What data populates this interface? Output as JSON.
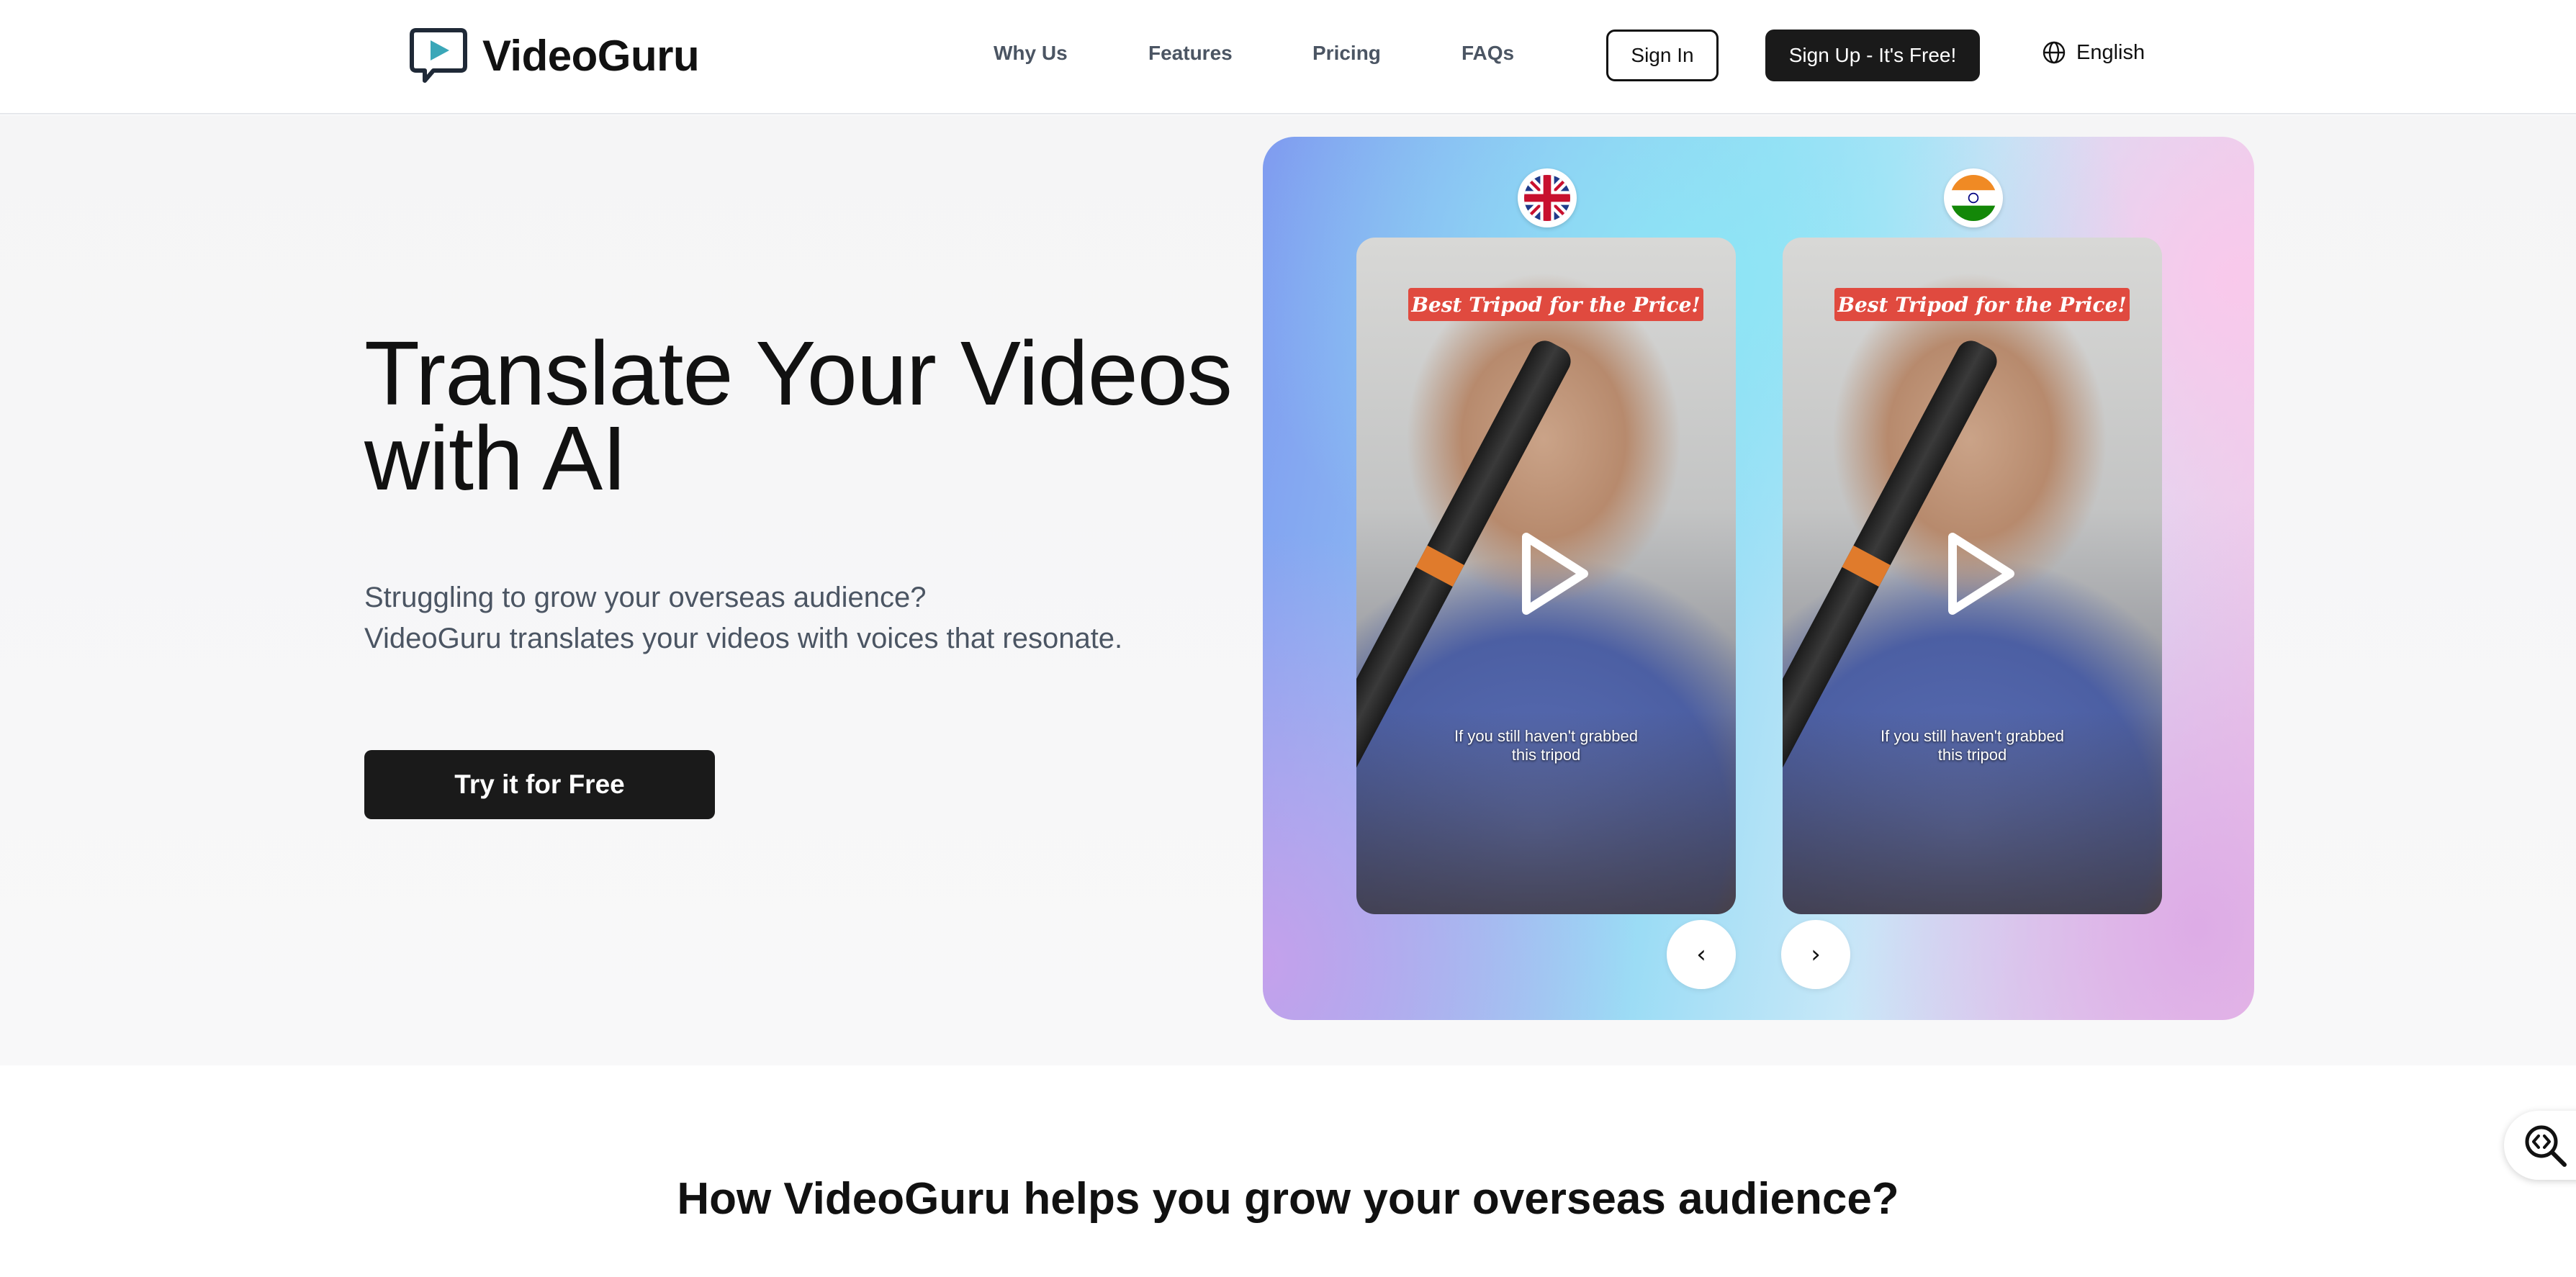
{
  "brand": {
    "name": "VideoGuru",
    "accent": "#3aa7b8"
  },
  "nav": {
    "links": [
      "Why Us",
      "Features",
      "Pricing",
      "FAQs"
    ],
    "sign_in": "Sign In",
    "sign_up": "Sign Up - It's Free!",
    "language": "English"
  },
  "hero": {
    "title_line1": "Translate Your Videos",
    "title_line2": "with AI",
    "subtitle_line1": "Struggling to grow your overseas audience?",
    "subtitle_line2": "VideoGuru translates your videos with voices that resonate.",
    "cta": "Try it for Free"
  },
  "showcase": {
    "videos": [
      {
        "flag": "uk-flag-icon",
        "caption_top": "Best Tripod for the Price!",
        "caption_bottom_1": "If you still haven't grabbed",
        "caption_bottom_2": "this tripod"
      },
      {
        "flag": "india-flag-icon",
        "caption_top": "Best Tripod for the Price!",
        "caption_bottom_1": "If you still haven't grabbed",
        "caption_bottom_2": "this tripod"
      }
    ],
    "prev": "‹",
    "next": "›"
  },
  "section": {
    "title": "How VideoGuru helps you grow your overseas audience?"
  }
}
